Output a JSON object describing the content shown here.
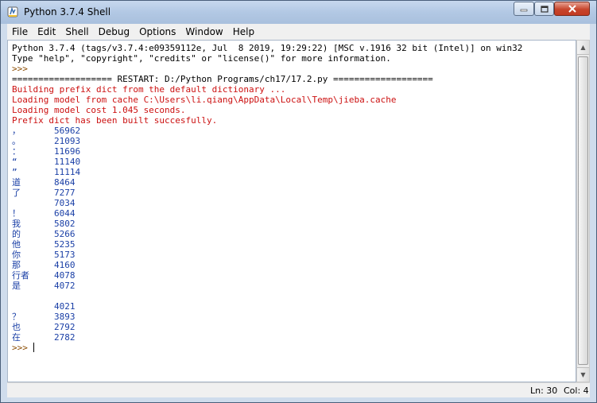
{
  "window": {
    "title": "Python 3.7.4 Shell"
  },
  "menu": [
    "File",
    "Edit",
    "Shell",
    "Debug",
    "Options",
    "Window",
    "Help"
  ],
  "shell": {
    "banner": [
      "Python 3.7.4 (tags/v3.7.4:e09359112e, Jul  8 2019, 19:29:22) [MSC v.1916 32 bit (Intel)] on win32",
      "Type \"help\", \"copyright\", \"credits\" or \"license()\" for more information."
    ],
    "prompt": ">>> ",
    "restart_line": "=================== RESTART: D:/Python Programs/ch17/17.2.py ===================",
    "log_lines": [
      "Building prefix dict from the default dictionary ...",
      "Loading model from cache C:\\Users\\li.qiang\\AppData\\Local\\Temp\\jieba.cache",
      "Loading model cost 1.045 seconds.",
      "Prefix dict has been built succesfully."
    ],
    "results": [
      {
        "token": "，",
        "count": "56962"
      },
      {
        "token": "。",
        "count": "21093"
      },
      {
        "token": "：",
        "count": "11696"
      },
      {
        "token": "“",
        "count": "11140"
      },
      {
        "token": "”",
        "count": "11114"
      },
      {
        "token": "道",
        "count": "8464"
      },
      {
        "token": "了",
        "count": "7277"
      },
      {
        "token": " ",
        "count": "7034"
      },
      {
        "token": "！",
        "count": "6044"
      },
      {
        "token": "我",
        "count": "5802"
      },
      {
        "token": "的",
        "count": "5266"
      },
      {
        "token": "他",
        "count": "5235"
      },
      {
        "token": "你",
        "count": "5173"
      },
      {
        "token": "那",
        "count": "4160"
      },
      {
        "token": "行者",
        "count": "4078"
      },
      {
        "token": "是",
        "count": "4072"
      },
      {
        "token": "\n",
        "count": "4021"
      },
      {
        "token": "？",
        "count": "3893"
      },
      {
        "token": "也",
        "count": "2792"
      },
      {
        "token": "在",
        "count": "2782"
      }
    ]
  },
  "status": {
    "line": "Ln: 30",
    "col": "Col: 4"
  }
}
